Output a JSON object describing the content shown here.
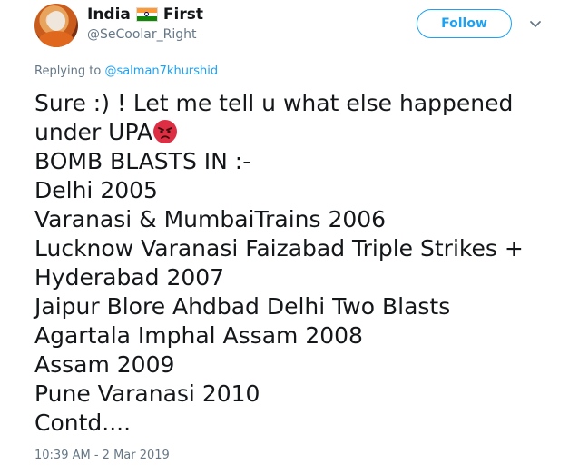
{
  "author": {
    "name": "India",
    "name_suffix": "First",
    "handle": "@SeCoolar_Right",
    "flag_icon": "india-flag-icon"
  },
  "actions": {
    "follow_label": "Follow",
    "menu_icon": "chevron-down-icon"
  },
  "reply": {
    "prefix": "Replying to",
    "to_handle": "@salman7khurshid"
  },
  "tweet": {
    "lines": [
      "Sure :) ! Let me tell u what else happened",
      "under UPA",
      "BOMB BLASTS IN :-",
      "Delhi 2005",
      "Varanasi & MumbaiTrains 2006",
      "Lucknow Varanasi Faizabad Triple Strikes +",
      "Hyderabad 2007",
      "Jaipur Blore Ahdbad Delhi Two Blasts",
      "Agartala Imphal Assam 2008",
      "Assam 2009",
      "Pune Varanasi 2010",
      "Contd...."
    ],
    "emoji": "angry-face-icon",
    "timestamp": "10:39 AM - 2 Mar 2019"
  },
  "colors": {
    "accent": "#1da1f2",
    "secondary_text": "#657786",
    "primary_text": "#14171a"
  }
}
